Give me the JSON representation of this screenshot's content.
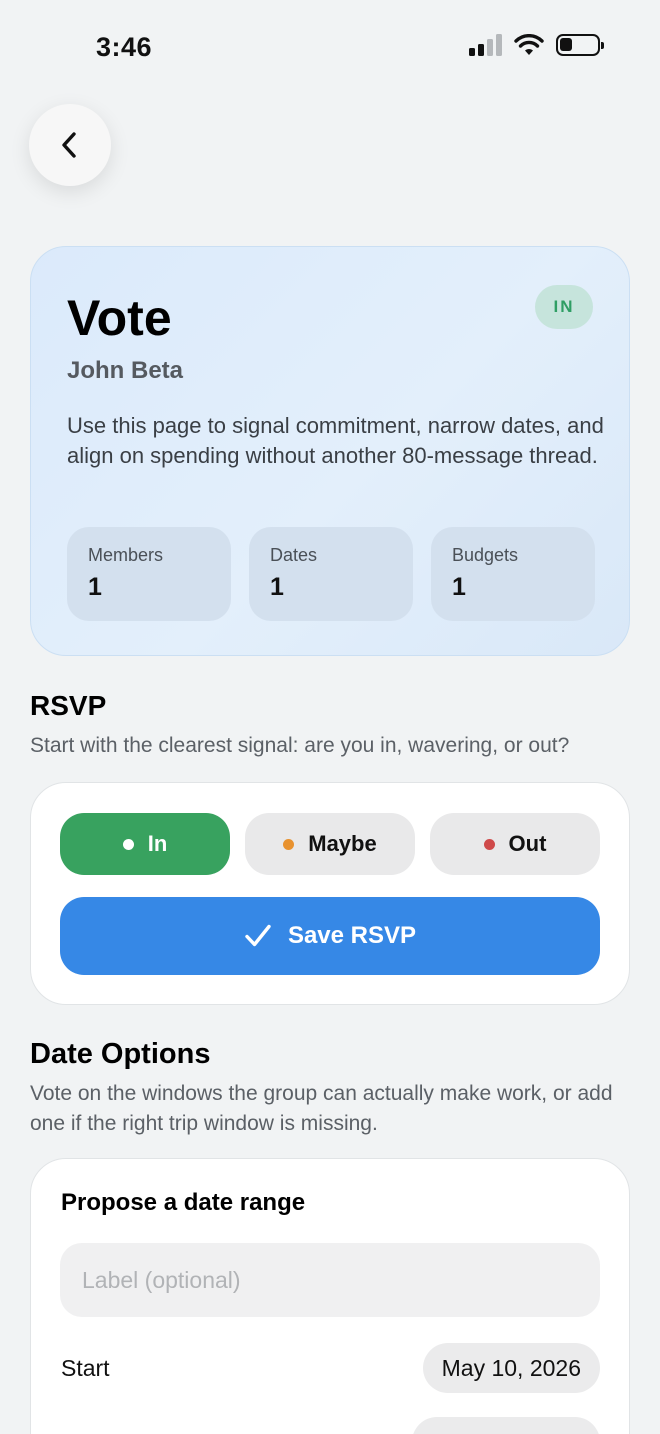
{
  "status_bar": {
    "time": "3:46"
  },
  "hero": {
    "title": "Vote",
    "badge": "IN",
    "subtitle": "John Beta",
    "description": "Use this page to signal commitment, narrow dates, and align on spending without another 80-message thread.",
    "stats": [
      {
        "label": "Members",
        "value": "1"
      },
      {
        "label": "Dates",
        "value": "1"
      },
      {
        "label": "Budgets",
        "value": "1"
      }
    ]
  },
  "rsvp": {
    "title": "RSVP",
    "description": "Start with the clearest signal: are you in, wavering, or out?",
    "options": [
      {
        "label": "In",
        "dot_color": "#ffffff",
        "selected": true
      },
      {
        "label": "Maybe",
        "dot_color": "#e8922f",
        "selected": false
      },
      {
        "label": "Out",
        "dot_color": "#cf4a4a",
        "selected": false
      }
    ],
    "save_label": "Save RSVP"
  },
  "date_options": {
    "title": "Date Options",
    "description": "Vote on the windows the group can actually make work, or add one if the right trip window is missing.",
    "form": {
      "title": "Propose a date range",
      "label_placeholder": "Label (optional)",
      "start_label": "Start",
      "start_value": "May 10, 2026"
    }
  },
  "colors": {
    "accent_blue": "#3688e6",
    "in_green": "#38a25f",
    "badge_bg": "#c6e4dc",
    "badge_text": "#2f9e64"
  },
  "icons": {
    "back": "chevron-left-icon",
    "save": "checkmark-icon",
    "signal": "cellular-signal-icon",
    "wifi": "wifi-icon",
    "battery": "battery-icon"
  }
}
